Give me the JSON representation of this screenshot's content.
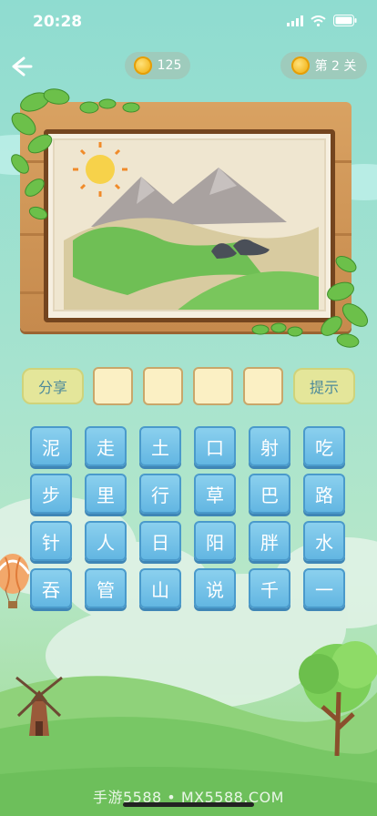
{
  "status": {
    "time": "20:28"
  },
  "topbar": {
    "coins": "125",
    "level": "第 2 关",
    "back_icon": "back-arrow-icon"
  },
  "answer": {
    "share_label": "分享",
    "hint_label": "提示",
    "slots": [
      "",
      "",
      "",
      ""
    ]
  },
  "letters": [
    "泥",
    "走",
    "土",
    "口",
    "射",
    "吃",
    "步",
    "里",
    "行",
    "草",
    "巴",
    "路",
    "针",
    "人",
    "日",
    "阳",
    "胖",
    "水",
    "吞",
    "管",
    "山",
    "说",
    "千",
    "一"
  ],
  "watermark": "手游5588 • MX5588.COM",
  "colors": {
    "tile": "#6cbde6",
    "pill": "#e4e69a",
    "slot": "#fbf0c4",
    "board": "#d29a5c",
    "sky": "#8fdcd0"
  }
}
